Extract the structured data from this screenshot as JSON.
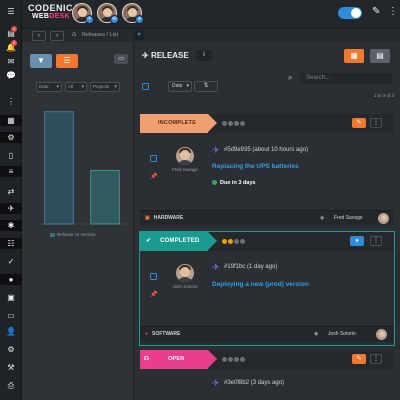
{
  "header": {
    "logo_line1": "CODENICA",
    "logo_line2_a": "WEB",
    "logo_line2_b": "DESK"
  },
  "subheader": {
    "back": "‹",
    "forward": "›",
    "crumb": "Releases / List"
  },
  "filter": {
    "selects": [
      "Date",
      "All",
      "Projects"
    ],
    "chart_legend": "Release vs Version"
  },
  "chart_data": {
    "type": "bar",
    "categories": [
      "",
      ""
    ],
    "series": [
      {
        "values": [
          92,
          44
        ]
      }
    ],
    "ylim": [
      0,
      100
    ],
    "title": "",
    "xlabel": "",
    "ylabel": ""
  },
  "main": {
    "title": "RELEASE",
    "search_placeholder": "Search...",
    "date_select": "Date",
    "pager": "1 to 3 of 3",
    "cards": [
      {
        "status": "INCOMPLETE",
        "person_name": "Fred Savage",
        "release_id": "#5d9e935 (about 10 hours ago)",
        "release_title": "Replacing the UPS batteries",
        "due": "Due in 3 days",
        "tag": "HARDWARE",
        "owner": "Fred Savage"
      },
      {
        "status": "COMPLETED",
        "person_name": "Josh Sotorio",
        "release_id": "#19f1bc (1 day ago)",
        "release_title": "Deploying a new (prod) version",
        "tag": "SOFTWARE",
        "owner": "Josh Sotorio"
      },
      {
        "status": "OPEN",
        "release_id": "#3e0f8b2 (3 days ago)"
      }
    ]
  },
  "colors": {
    "accent_orange": "#f0782f",
    "accent_blue": "#2f8bdc",
    "completed_teal": "#1b9a8f",
    "open_pink": "#e83e8c",
    "incomplete_peach": "#f0a070"
  }
}
